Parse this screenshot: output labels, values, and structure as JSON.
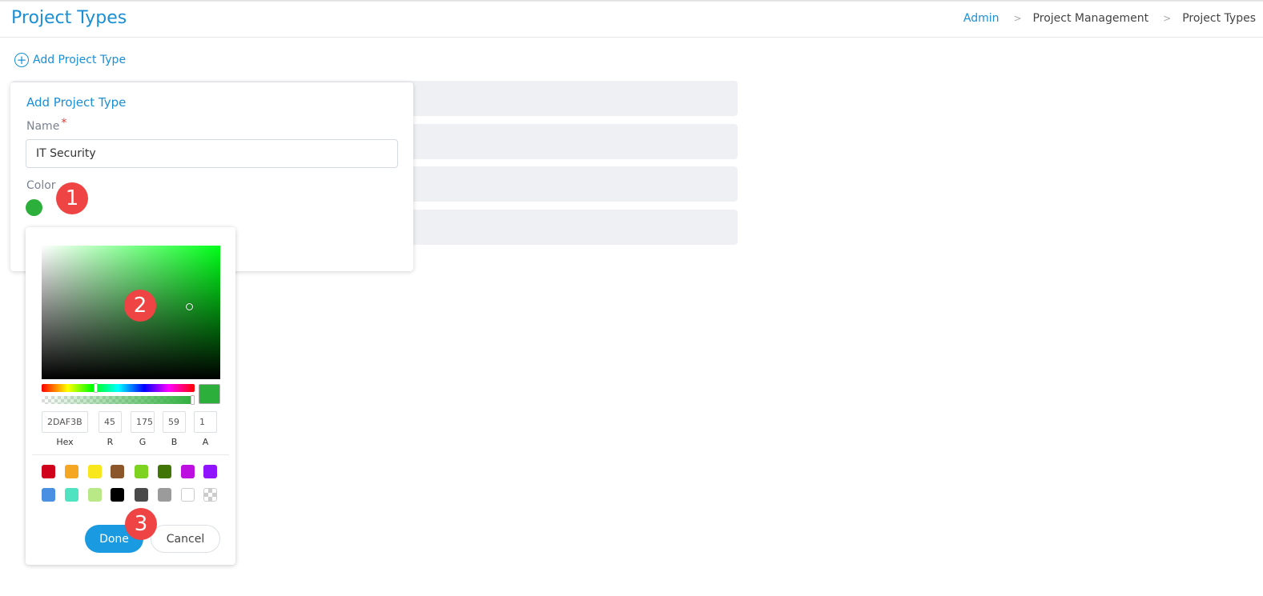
{
  "header": {
    "title": "Project Types",
    "breadcrumb": [
      {
        "label": "Admin",
        "link": true
      },
      {
        "label": "Project Management",
        "link": false
      },
      {
        "label": "Project Types",
        "link": false
      }
    ],
    "separator": ">"
  },
  "toolbar": {
    "add_label": "Add Project Type",
    "add_icon": "plus-circle-icon"
  },
  "list": {
    "row_count": 4
  },
  "form": {
    "title": "Add Project Type",
    "name_label": "Name",
    "required_mark": "*",
    "name_value": "IT Security",
    "color_label": "Color",
    "color_value": "#2DAF3B"
  },
  "picker": {
    "hex": "2DAF3B",
    "r": "45",
    "g": "175",
    "b": "59",
    "a": "1",
    "labels": {
      "hex": "Hex",
      "r": "R",
      "g": "G",
      "b": "B",
      "a": "A"
    },
    "swatches_row1": [
      "#D0021B",
      "#F5A623",
      "#F8E71C",
      "#8B572A",
      "#7ED321",
      "#417505",
      "#BD10E0",
      "#9013FE"
    ],
    "swatches_row2": [
      "#4A90E2",
      "#50E3C2",
      "#B8E986",
      "#000000",
      "#4A4A4A",
      "#9B9B9B",
      "#FFFFFF",
      "transparent"
    ],
    "done_label": "Done",
    "cancel_label": "Cancel"
  },
  "annotations": [
    "1",
    "2",
    "3"
  ]
}
